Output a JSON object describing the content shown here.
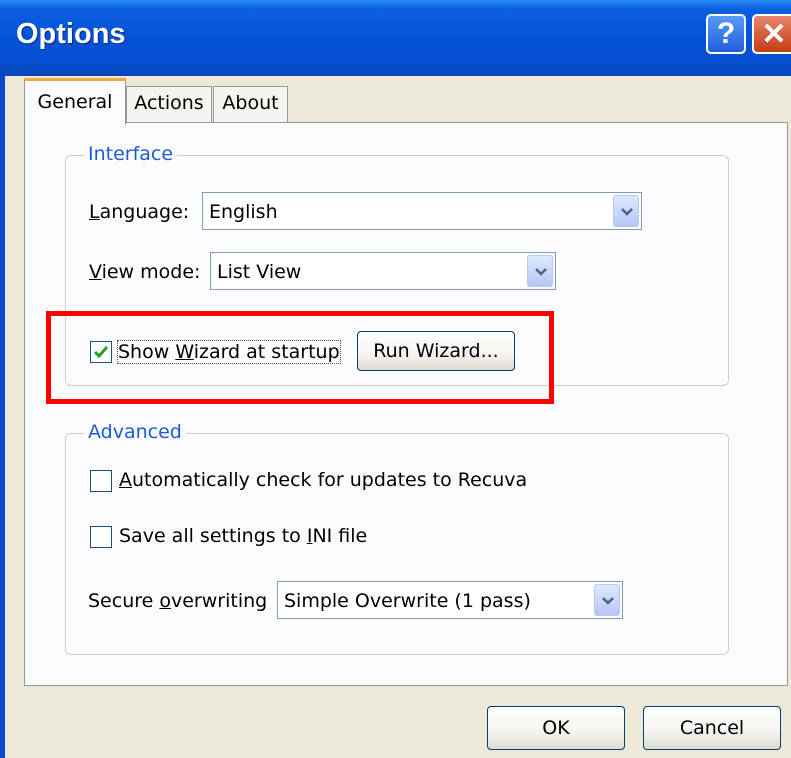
{
  "window": {
    "title": "Options",
    "help_glyph": "?",
    "close_glyph": "✕"
  },
  "tabs": [
    {
      "label": "General",
      "active": true
    },
    {
      "label": "Actions",
      "active": false
    },
    {
      "label": "About",
      "active": false
    }
  ],
  "interface": {
    "legend": "Interface",
    "language": {
      "label": "Language:",
      "accelerator": "L",
      "value": "English"
    },
    "view_mode": {
      "label": "View mode:",
      "accelerator": "V",
      "value": "List View"
    },
    "show_wizard": {
      "label": "Show Wizard at startup",
      "accelerator": "W",
      "checked": true
    },
    "run_wizard_label": "Run Wizard..."
  },
  "advanced": {
    "legend": "Advanced",
    "auto_update": {
      "label": "Automatically check for updates to Recuva",
      "accelerator": "A",
      "checked": false
    },
    "ini_file": {
      "label": "Save all settings to INI file",
      "accelerator": "I",
      "checked": false
    },
    "secure_overwriting": {
      "label": "Secure overwriting",
      "accelerator": "o",
      "value": "Simple Overwrite (1 pass)"
    }
  },
  "buttons": {
    "ok": "OK",
    "cancel": "Cancel"
  },
  "icons": {
    "dropdown": "chevron-down-icon",
    "check": "checkmark-icon",
    "help": "help-icon",
    "close": "close-icon"
  },
  "colors": {
    "title_bar": "#0653d8",
    "highlight": "#ff0000",
    "group_legend": "#1b5bd6",
    "face": "#ece9d8"
  }
}
